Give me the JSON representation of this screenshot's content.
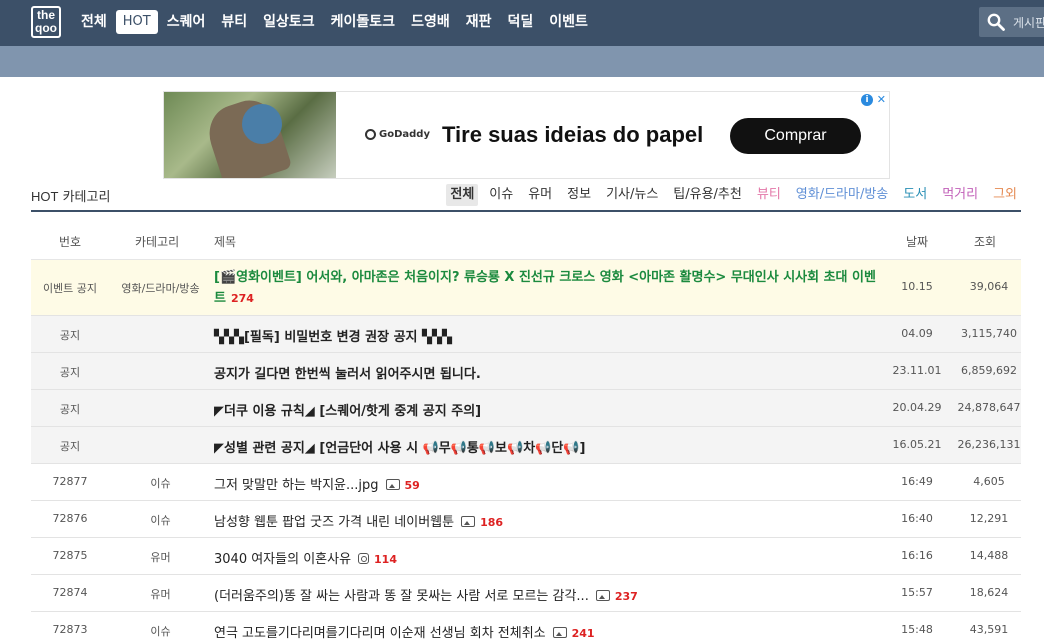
{
  "logo": {
    "line1": "the",
    "line2": "qoo"
  },
  "nav": [
    {
      "label": "전체",
      "active": false
    },
    {
      "label": "HOT",
      "active": true
    },
    {
      "label": "스퀘어",
      "active": false
    },
    {
      "label": "뷰티",
      "active": false
    },
    {
      "label": "일상토크",
      "active": false
    },
    {
      "label": "케이돌토크",
      "active": false
    },
    {
      "label": "드영배",
      "active": false
    },
    {
      "label": "재판",
      "active": false
    },
    {
      "label": "덕딜",
      "active": false
    },
    {
      "label": "이벤트",
      "active": false
    }
  ],
  "search": {
    "placeholder": "게시판"
  },
  "ad": {
    "brand": "GoDaddy",
    "headline": "Tire suas ideias do papel",
    "cta": "Comprar",
    "info": "i",
    "close": "✕"
  },
  "category": {
    "title_prefix": "HOT",
    "title": "카테고리",
    "tabs": [
      {
        "label": "전체",
        "active": true,
        "color": "#333333"
      },
      {
        "label": "이슈",
        "active": false,
        "color": "#333333"
      },
      {
        "label": "유머",
        "active": false,
        "color": "#333333"
      },
      {
        "label": "정보",
        "active": false,
        "color": "#333333"
      },
      {
        "label": "기사/뉴스",
        "active": false,
        "color": "#333333"
      },
      {
        "label": "팁/유용/추천",
        "active": false,
        "color": "#333333"
      },
      {
        "label": "뷰티",
        "active": false,
        "color": "#e377a8"
      },
      {
        "label": "영화/드라마/방송",
        "active": false,
        "color": "#5f8fd6"
      },
      {
        "label": "도서",
        "active": false,
        "color": "#2a8fb5"
      },
      {
        "label": "먹거리",
        "active": false,
        "color": "#c15fb8"
      },
      {
        "label": "그외",
        "active": false,
        "color": "#e58a52"
      }
    ]
  },
  "table": {
    "headers": {
      "no": "번호",
      "cat": "카테고리",
      "title": "제목",
      "date": "날짜",
      "views": "조회"
    },
    "event_row": {
      "no": "이벤트 공지",
      "cat": "영화/드라마/방송",
      "title": "[🎬영화이벤트] 어서와, 아마존은 처음이지? 류승룡 X 진선규 크로스 영화 <아마존 활명수> 무대인사 시사회 초대 이벤트",
      "comments": "274",
      "date": "10.15",
      "views": "39,064"
    },
    "notices": [
      {
        "no": "공지",
        "title": "▚▚▚[필독] 비밀번호 변경 권장 공지 ▚▚▚",
        "date": "04.09",
        "views": "3,115,740"
      },
      {
        "no": "공지",
        "title": "공지가 길다면 한번씩 눌러서 읽어주시면 됩니다.",
        "date": "23.11.01",
        "views": "6,859,692"
      },
      {
        "no": "공지",
        "title": "◤더쿠 이용 규칙◢ [스퀘어/핫게 중계 공지 주의]",
        "date": "20.04.29",
        "views": "24,878,647"
      },
      {
        "no": "공지",
        "title": "◤성별 관련 공지◢ [언금단어 사용 시 📢무📢통📢보📢차📢단📢]",
        "date": "16.05.21",
        "views": "26,236,131"
      }
    ],
    "posts": [
      {
        "no": "72877",
        "cat": "이슈",
        "title": "그저 맞말만 하는 박지윤...jpg",
        "icon": "image-icon",
        "comments": "59",
        "date": "16:49",
        "views": "4,605"
      },
      {
        "no": "72876",
        "cat": "이슈",
        "title": "남성향 웹툰 팝업 굿즈 가격 내린 네이버웹툰",
        "icon": "image-icon",
        "comments": "186",
        "date": "16:40",
        "views": "12,291"
      },
      {
        "no": "72875",
        "cat": "유머",
        "title": "3040 여자들의 이혼사유",
        "icon": "instagram-icon",
        "comments": "114",
        "date": "16:16",
        "views": "14,488"
      },
      {
        "no": "72874",
        "cat": "유머",
        "title": "(더러움주의)똥 잘 싸는 사람과 똥 잘 못싸는 사람 서로 모르는 감각...",
        "icon": "image-icon",
        "comments": "237",
        "date": "15:57",
        "views": "18,624"
      },
      {
        "no": "72873",
        "cat": "이슈",
        "title": "연극 고도를기다리며를기다리며 이순재 선생님 회차 전체취소",
        "icon": "image-icon",
        "comments": "241",
        "date": "15:48",
        "views": "43,591"
      }
    ]
  }
}
